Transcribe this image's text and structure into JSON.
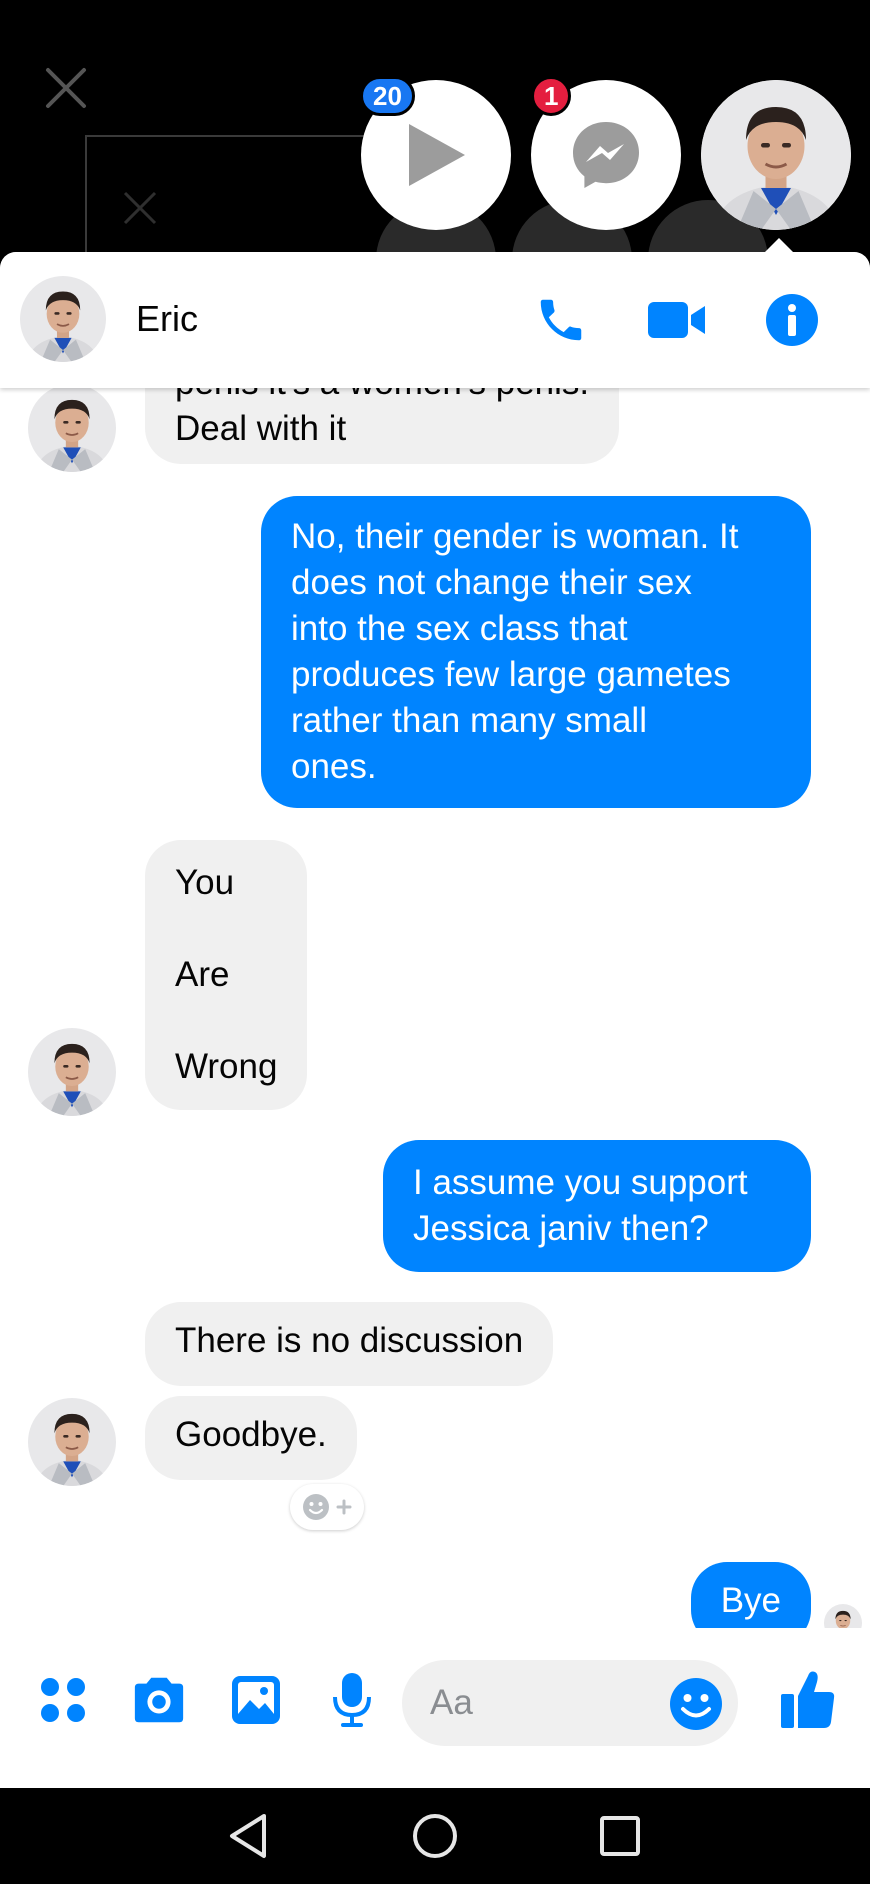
{
  "chat_heads": {
    "video_badge": "20",
    "messenger_badge": "1"
  },
  "header": {
    "contact_name": "Eric"
  },
  "messages": [
    {
      "from": "them",
      "lines": [
        "penis it's a women's penis.",
        "Deal with it"
      ]
    },
    {
      "from": "me",
      "lines": [
        "No, their gender is woman. It",
        "does not change their sex",
        "into the sex class that",
        "produces few large gametes",
        "rather than many small",
        "ones."
      ]
    },
    {
      "from": "them",
      "lines": [
        "You",
        "",
        "Are",
        "",
        "Wrong"
      ]
    },
    {
      "from": "me",
      "lines": [
        "I assume you support",
        "Jessica janiv then?"
      ]
    },
    {
      "from": "them",
      "lines": [
        "There is no discussion"
      ]
    },
    {
      "from": "them",
      "lines": [
        "Goodbye."
      ]
    },
    {
      "from": "me",
      "lines": [
        "Bye"
      ]
    }
  ],
  "composer": {
    "placeholder": "Aa"
  },
  "colors": {
    "accent": "#0084ff",
    "incoming_bubble": "#f0f0f0",
    "badge_blue": "#1877f2",
    "badge_red": "#e41e3f"
  },
  "icons": [
    "close-icon",
    "play-icon",
    "messenger-icon",
    "phone-icon",
    "video-call-icon",
    "info-icon",
    "apps-icon",
    "camera-icon",
    "gallery-icon",
    "microphone-icon",
    "emoji-icon",
    "thumbs-up-icon",
    "back-icon",
    "home-icon",
    "recents-icon"
  ]
}
